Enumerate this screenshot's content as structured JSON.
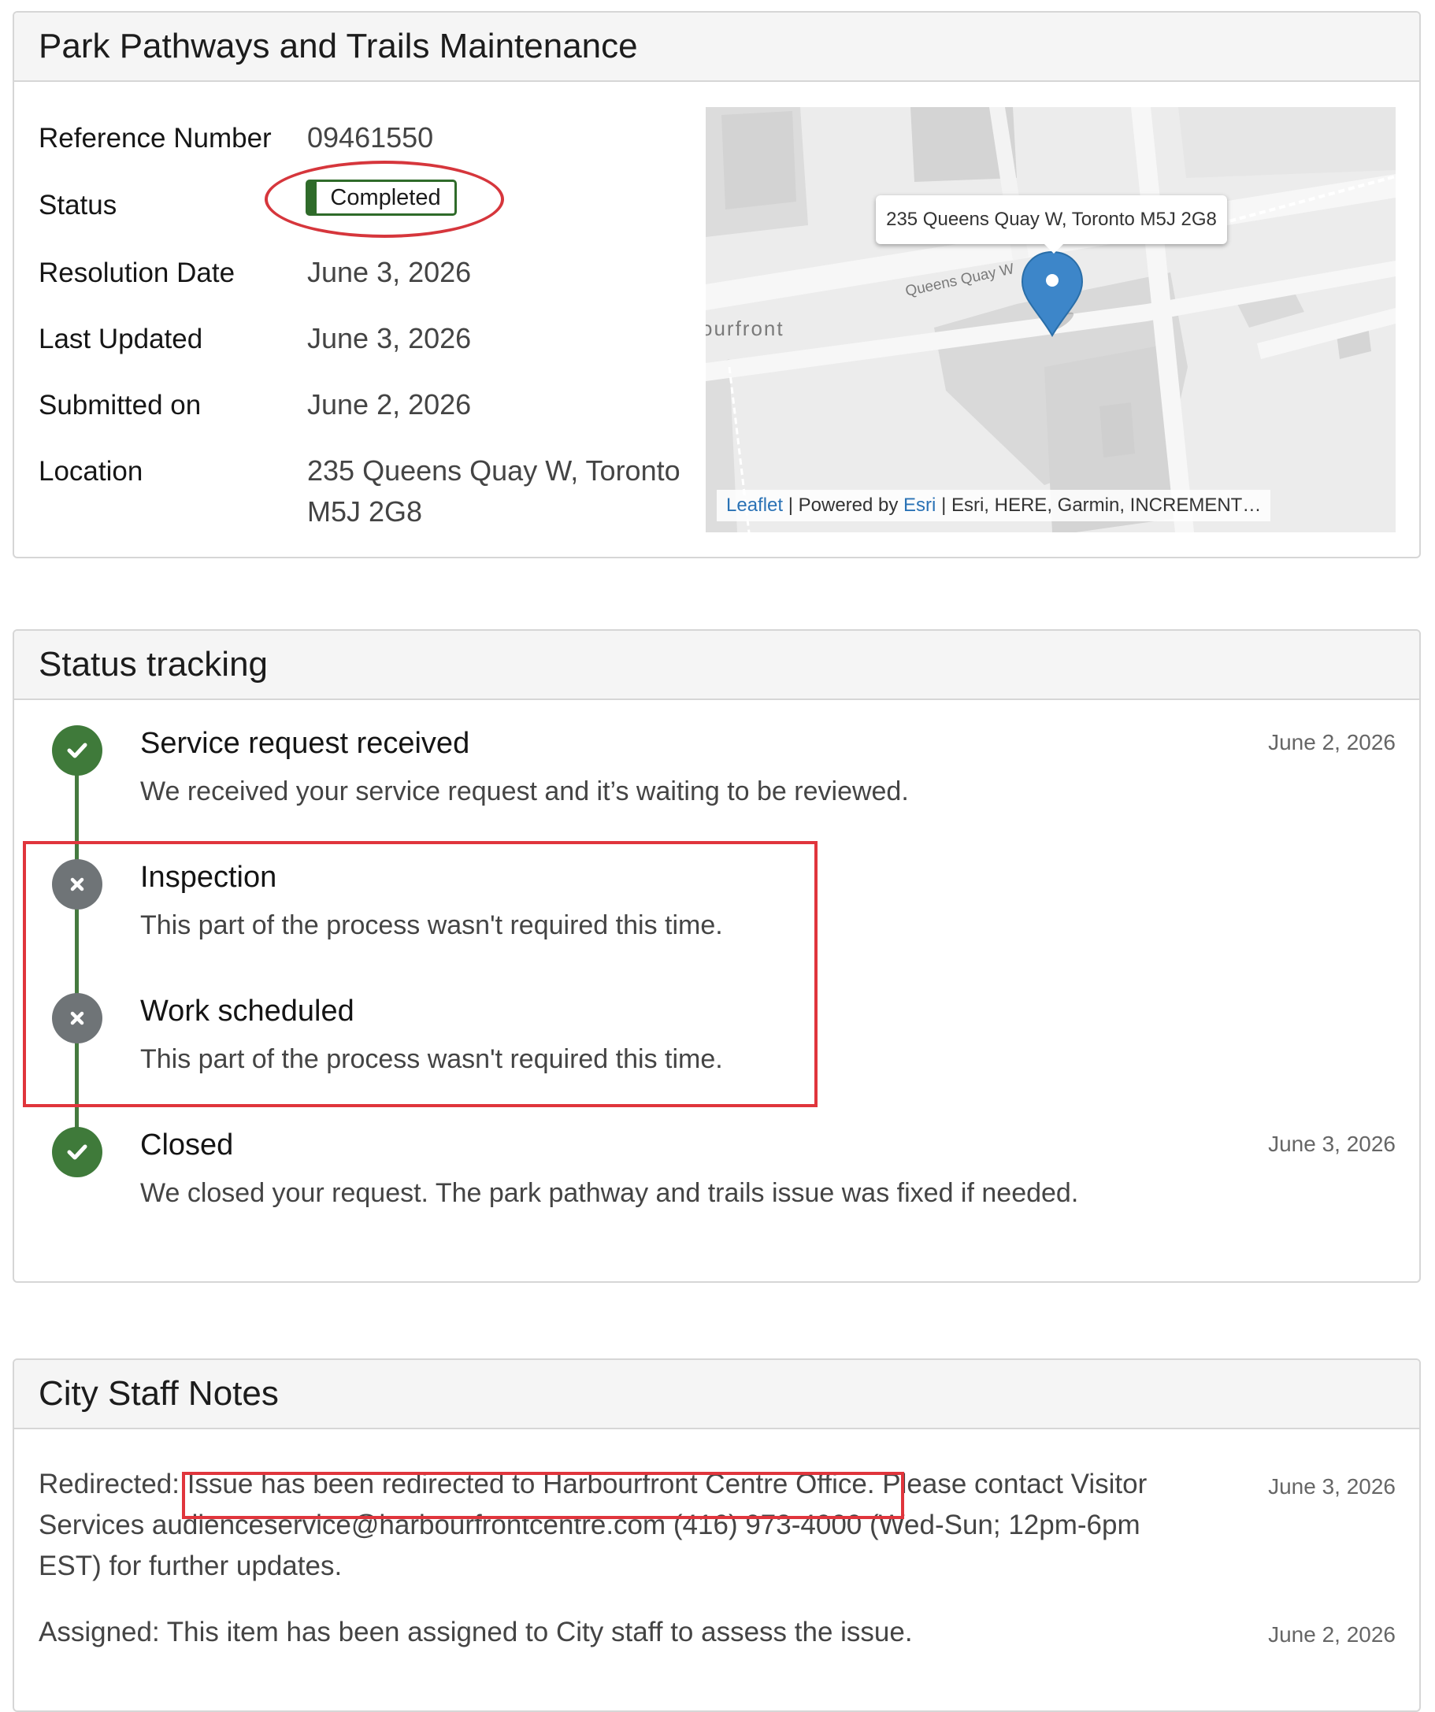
{
  "details": {
    "title": "Park Pathways and Trails Maintenance",
    "fields": [
      {
        "label": "Reference Number",
        "value": "09461550"
      },
      {
        "label": "Status",
        "value": "Completed"
      },
      {
        "label": "Resolution Date",
        "value": "June 3, 2026"
      },
      {
        "label": "Last Updated",
        "value": "June 3, 2026"
      },
      {
        "label": "Submitted on",
        "value": "June 2, 2026"
      },
      {
        "label": "Location",
        "value_line1": "235 Queens Quay W, Toronto",
        "value_line2": "M5J 2G8"
      }
    ],
    "status_color": "#2f6b2a",
    "map": {
      "popup": "235 Queens Quay W, Toronto M5J 2G8",
      "street_label": "Queens Quay W",
      "area_label": "ourfront",
      "attribution": {
        "leaflet": "Leaflet",
        "powered_by": "| Powered by",
        "esri": "Esri",
        "sources": "| Esri, HERE, Garmin, INCREMENT…"
      }
    }
  },
  "tracking": {
    "title": "Status tracking",
    "steps": [
      {
        "title": "Service request received",
        "description": "We received your service request and it’s waiting to be reviewed.",
        "date": "June 2, 2026",
        "state": "done",
        "icon": "check-icon"
      },
      {
        "title": "Inspection",
        "description": "This part of the process wasn't required this time.",
        "date": "",
        "state": "skipped",
        "icon": "x-icon"
      },
      {
        "title": "Work scheduled",
        "description": "This part of the process wasn't required this time.",
        "date": "",
        "state": "skipped",
        "icon": "x-icon"
      },
      {
        "title": "Closed",
        "description": "We closed your request. The park pathway and trails issue was fixed if needed.",
        "date": "June 3, 2026",
        "state": "done",
        "icon": "check-icon"
      }
    ]
  },
  "notes": {
    "title": "City Staff Notes",
    "items": [
      {
        "text": "Redirected: Issue has been redirected to Harbourfront Centre Office. Please contact Visitor Services  audienceservice@harbourfrontcentre.com (416) 973-4000 (Wed-Sun; 12pm-6pm EST) for further updates.",
        "date": "June 3, 2026"
      },
      {
        "text": "Assigned: This item has been assigned to City staff to assess the issue.",
        "date": "June 2, 2026"
      }
    ]
  },
  "colors": {
    "done": "#3f7a3a",
    "skipped": "#6f7477",
    "annotation": "#e0353c",
    "link": "#2a72b5"
  }
}
